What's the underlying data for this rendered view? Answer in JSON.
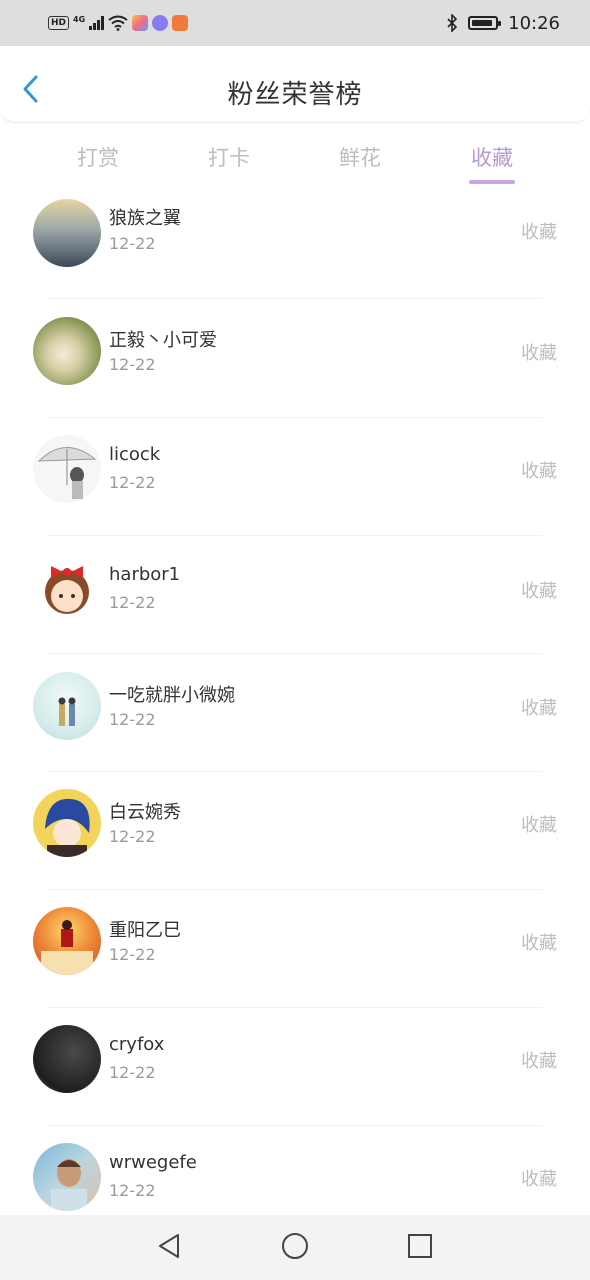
{
  "status_bar": {
    "hd": "HD",
    "network": "4G",
    "time": "10:26",
    "app_icon_colors": [
      "#f0a04b",
      "#8a7cf0",
      "#f07a3a"
    ]
  },
  "header": {
    "title": "粉丝荣誉榜",
    "back_icon": "chevron-left-icon",
    "accent": "#2a9be0"
  },
  "tabs": [
    {
      "label": "打赏",
      "active": false
    },
    {
      "label": "打卡",
      "active": false
    },
    {
      "label": "鲜花",
      "active": false
    },
    {
      "label": "收藏",
      "active": true
    }
  ],
  "list": [
    {
      "name": "狼族之翼",
      "date": "12-22",
      "action": "收藏"
    },
    {
      "name": "正毅丶小可爱",
      "date": "12-22",
      "action": "收藏"
    },
    {
      "name": "licock",
      "date": "12-22",
      "action": "收藏"
    },
    {
      "name": "harbor1",
      "date": "12-22",
      "action": "收藏"
    },
    {
      "name": "一吃就胖小微婉",
      "date": "12-22",
      "action": "收藏"
    },
    {
      "name": "白云婉秀",
      "date": "12-22",
      "action": "收藏"
    },
    {
      "name": "重阳乙巳",
      "date": "12-22",
      "action": "收藏"
    },
    {
      "name": "cryfox",
      "date": "12-22",
      "action": "收藏"
    },
    {
      "name": "wrwegefe",
      "date": "12-22",
      "action": "收藏"
    }
  ],
  "nav_bar": {
    "back": "triangle-back-icon",
    "home": "circle-home-icon",
    "recent": "square-recent-icon"
  }
}
